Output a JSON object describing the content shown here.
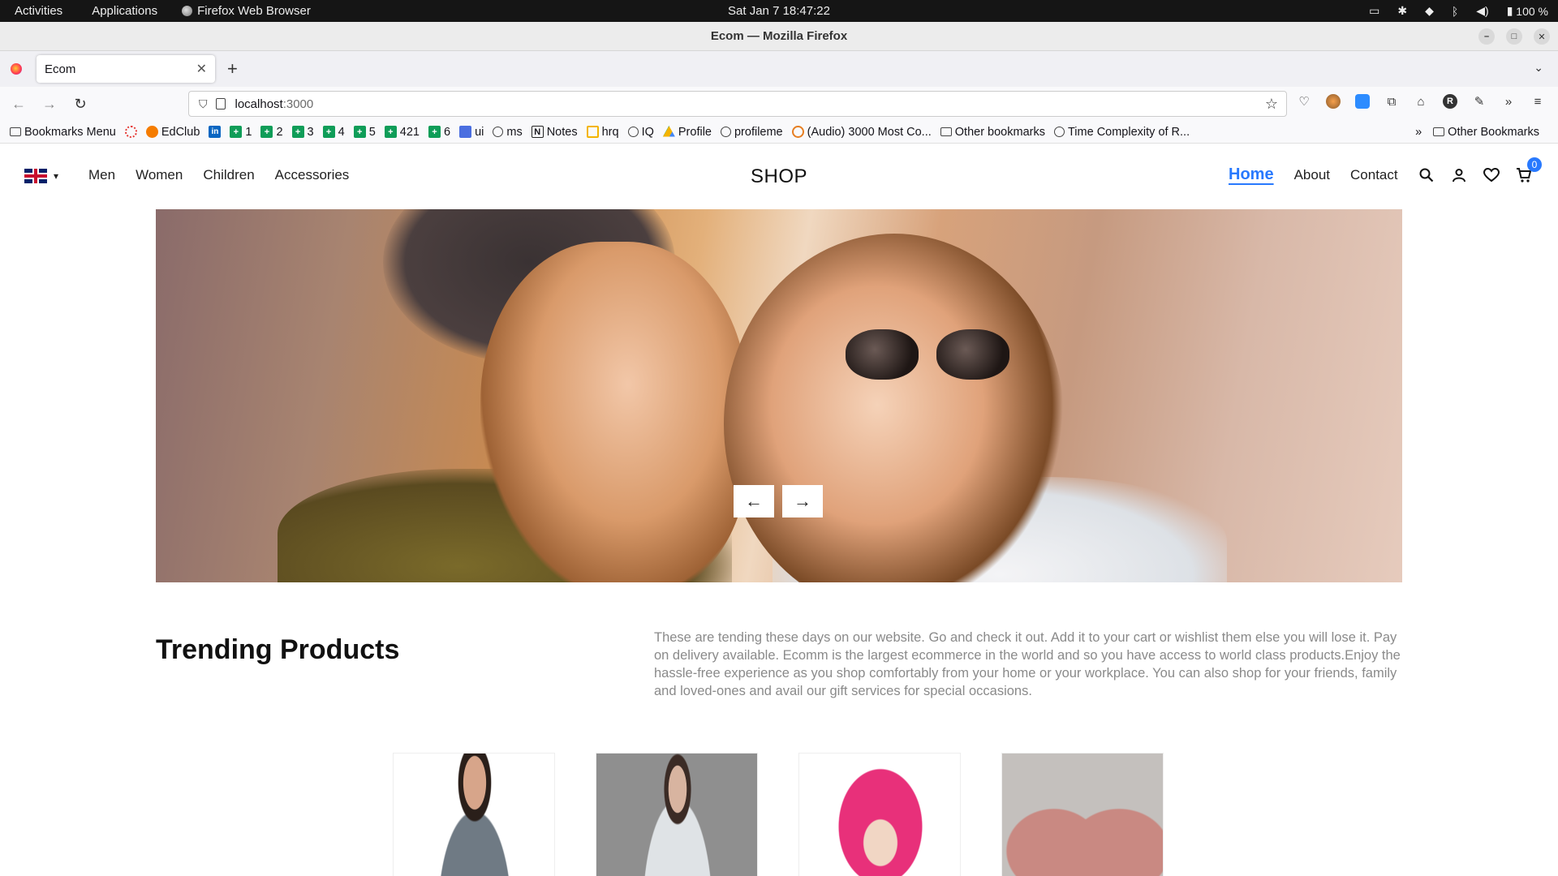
{
  "system_bar": {
    "activities": "Activities",
    "applications": "Applications",
    "app_name": "Firefox Web Browser",
    "clock": "Sat Jan 7  18:47:22",
    "battery": "100 %"
  },
  "window": {
    "title": "Ecom — Mozilla Firefox"
  },
  "tabs": [
    {
      "label": "Ecom",
      "close": "✕"
    }
  ],
  "new_tab_label": "+",
  "url": {
    "host": "localhost",
    "port": ":3000"
  },
  "bookmarks": {
    "items": [
      {
        "label": "Bookmarks Menu",
        "icon": "folder-icon"
      },
      {
        "label": "",
        "icon": "ring-icon"
      },
      {
        "label": "EdClub",
        "icon": "edclub-icon"
      },
      {
        "label": "",
        "icon": "linkedin-icon"
      },
      {
        "label": "1",
        "icon": "sheets-icon"
      },
      {
        "label": "2",
        "icon": "sheets-icon"
      },
      {
        "label": "3",
        "icon": "sheets-icon"
      },
      {
        "label": "4",
        "icon": "sheets-icon"
      },
      {
        "label": "5",
        "icon": "sheets-icon"
      },
      {
        "label": "421",
        "icon": "sheets-icon"
      },
      {
        "label": "6",
        "icon": "sheets-icon"
      },
      {
        "label": "ui",
        "icon": "docs-icon"
      },
      {
        "label": "ms",
        "icon": "globe-icon"
      },
      {
        "label": "Notes",
        "icon": "notion-icon"
      },
      {
        "label": "hrq",
        "icon": "hrq-icon"
      },
      {
        "label": "IQ",
        "icon": "globe-icon"
      },
      {
        "label": "Profile",
        "icon": "drive-icon"
      },
      {
        "label": "profileme",
        "icon": "globe-icon"
      },
      {
        "label": "(Audio) 3000 Most Co...",
        "icon": "audio-icon"
      },
      {
        "label": "Other bookmarks",
        "icon": "folder-icon"
      },
      {
        "label": "Time Complexity of R...",
        "icon": "globe-icon"
      }
    ],
    "overflow": "»",
    "other": "Other Bookmarks"
  },
  "site": {
    "nav_left": [
      "Men",
      "Women",
      "Children",
      "Accessories"
    ],
    "logo": "SHOP",
    "nav_right": [
      "Home",
      "About",
      "Contact"
    ],
    "cart_count": "0",
    "slider_prev": "←",
    "slider_next": "→",
    "trending_title": "Trending Products",
    "trending_desc": "These are tending these days on our website. Go and check it out. Add it to your cart or wishlist them else you will lose it. Pay on delivery available. Ecomm is the largest ecommerce in the world and so you have access to world class products.Enjoy the hassle-free experience as you shop comfortably from your home or your workplace. You can also shop for your friends, family and loved-ones and avail our gift services for special occasions."
  },
  "colors": {
    "accent": "#2879fe",
    "system_bar": "#151515"
  }
}
